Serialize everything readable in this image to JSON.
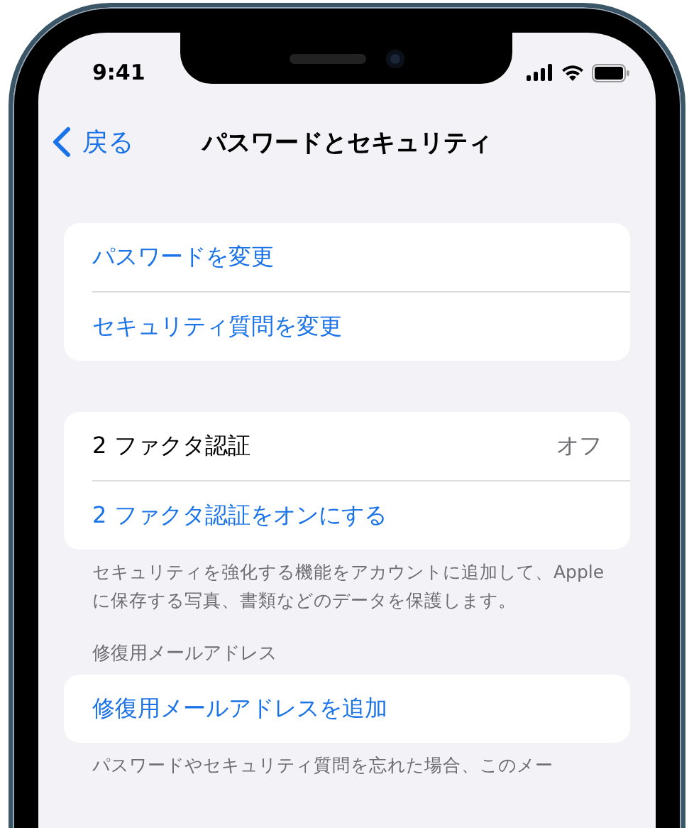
{
  "status_bar": {
    "time": "9:41"
  },
  "nav": {
    "back": "戻る",
    "title": "パスワードとセキュリティ"
  },
  "sections": [
    {
      "rows": [
        {
          "kind": "link",
          "label": "パスワードを変更"
        },
        {
          "kind": "link",
          "label": "セキュリティ質問を変更"
        }
      ]
    },
    {
      "rows": [
        {
          "kind": "value",
          "label": "2 ファクタ認証",
          "value": "オフ"
        },
        {
          "kind": "link",
          "label": "2 ファクタ認証をオンにする"
        }
      ],
      "footer": "セキュリティを強化する機能をアカウントに追加して、Apple に保存する写真、書類などのデータを保護します。"
    },
    {
      "header": "修復用メールアドレス",
      "rows": [
        {
          "kind": "link",
          "label": "修復用メールアドレスを追加"
        }
      ],
      "footer": "パスワードやセキュリティ質問を忘れた場合、このメー"
    }
  ]
}
